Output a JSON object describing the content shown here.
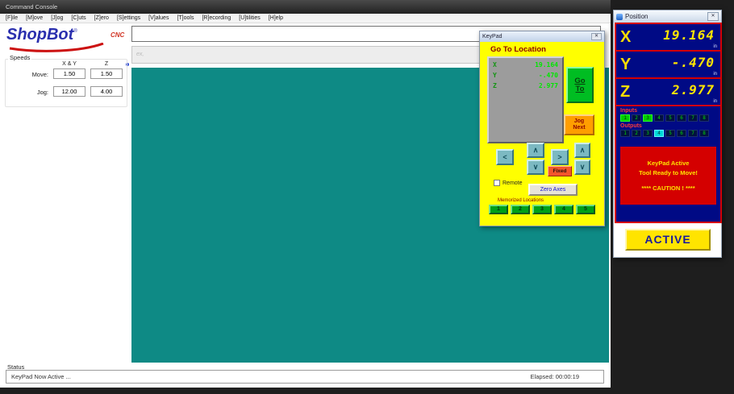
{
  "main_window": {
    "title": "Command Console",
    "menu": [
      "[F]ile",
      "[M]ove",
      "[J]og",
      "[C]uts",
      "[Z]ero",
      "[S]ettings",
      "[V]alues",
      "[T]ools",
      "[R]ecording",
      "[U]tilities",
      "[H]elp"
    ],
    "logo": {
      "brand": "ShopBot",
      "reg": "®",
      "cnc": "CNC"
    },
    "hint_box": {
      "text": "ex,"
    },
    "speeds": {
      "title": "Speeds",
      "col_xy": "X & Y",
      "col_z": "Z",
      "move_label": "Move:",
      "jog_label": "Jog:",
      "move_xy": "1.50",
      "move_z": "1.50",
      "jog_xy": "12.00",
      "jog_z": "4.00"
    },
    "status": {
      "label": "Status",
      "message": "KeyPad Now Active ...",
      "elapsed": "Elapsed: 00:00:19"
    }
  },
  "keypad": {
    "title": "KeyPad",
    "close": "✕",
    "header": "Go To Location",
    "display": {
      "rows": [
        {
          "axis": "X",
          "value": "19.164"
        },
        {
          "axis": "Y",
          "value": "-.470"
        },
        {
          "axis": "Z",
          "value": "2.977"
        }
      ]
    },
    "goto_line1": "Go",
    "goto_line2": "To",
    "jog_line1": "Jog",
    "jog_line2": "Next",
    "arrows": {
      "left": "<",
      "right": ">",
      "up": "∧",
      "down": "∨"
    },
    "fixed_label": "Fixed",
    "remote_label": "Remote",
    "zero_axes_label": "Zero Axes",
    "memorized_label": "Memorized Locations",
    "memory_buttons": [
      "1",
      "2",
      "3",
      "4",
      "5"
    ]
  },
  "position_window": {
    "title": "Position",
    "close": "✕",
    "axes": [
      {
        "label": "X",
        "value": "19.164",
        "unit": "in"
      },
      {
        "label": "Y",
        "value": "-.470",
        "unit": "in"
      },
      {
        "label": "Z",
        "value": "2.977",
        "unit": "in"
      }
    ],
    "inputs": {
      "label": "Inputs",
      "leds": [
        {
          "n": "1",
          "on": true
        },
        {
          "n": "2",
          "on": false
        },
        {
          "n": "3",
          "on": true
        },
        {
          "n": "4",
          "on": false
        },
        {
          "n": "5",
          "on": false
        },
        {
          "n": "6",
          "on": false
        },
        {
          "n": "7",
          "on": false
        },
        {
          "n": "8",
          "on": false
        }
      ]
    },
    "outputs": {
      "label": "Outputs",
      "leds": [
        {
          "n": "1",
          "on": false
        },
        {
          "n": "2",
          "on": false
        },
        {
          "n": "3",
          "on": false
        },
        {
          "n": "4",
          "on": true
        },
        {
          "n": "5",
          "on": false
        },
        {
          "n": "6",
          "on": false
        },
        {
          "n": "7",
          "on": false
        },
        {
          "n": "8",
          "on": false
        }
      ]
    },
    "message": [
      "KeyPad Active",
      "Tool Ready to Move!",
      "**** CAUTION ! ****"
    ],
    "active_label": "ACTIVE"
  }
}
